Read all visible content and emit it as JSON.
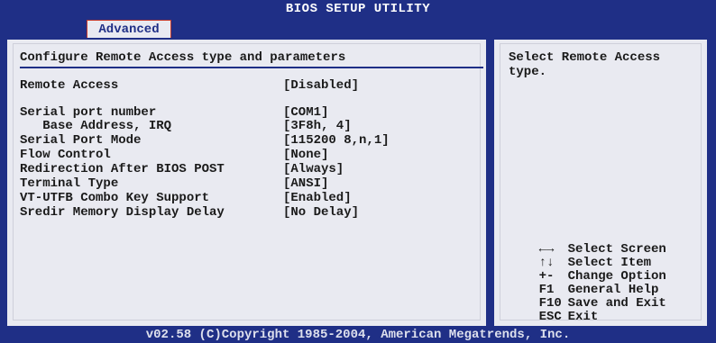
{
  "title": "BIOS SETUP UTILITY",
  "active_tab": "Advanced",
  "heading": "Configure Remote Access type and parameters",
  "settings": [
    {
      "label": "Remote Access",
      "value": "[Disabled]"
    },
    {
      "label": "Serial port number",
      "value": "[COM1]"
    },
    {
      "label": "   Base Address, IRQ",
      "value": "[3F8h, 4]"
    },
    {
      "label": "Serial Port Mode",
      "value": "[115200 8,n,1]"
    },
    {
      "label": "Flow Control",
      "value": "[None]"
    },
    {
      "label": "Redirection After BIOS POST",
      "value": "[Always]"
    },
    {
      "label": "Terminal Type",
      "value": "[ANSI]"
    },
    {
      "label": "VT-UTFB Combo Key Support",
      "value": "[Enabled]"
    },
    {
      "label": "Sredir Memory Display Delay",
      "value": "[No Delay]"
    }
  ],
  "help_text": "Select Remote Access type.",
  "key_legend": [
    {
      "key": "←→",
      "action": "Select Screen"
    },
    {
      "key": "↑↓",
      "action": "Select Item"
    },
    {
      "key": "+-",
      "action": "Change Option"
    },
    {
      "key": "F1",
      "action": "General Help"
    },
    {
      "key": "F10",
      "action": "Save and Exit"
    },
    {
      "key": "ESC",
      "action": "Exit"
    }
  ],
  "footer": "v02.58 (C)Copyright 1985-2004, American Megatrends, Inc.",
  "colors": {
    "background": "#1f2f86",
    "panel": "#e9eaf1",
    "tab_border": "#c63c2c"
  }
}
